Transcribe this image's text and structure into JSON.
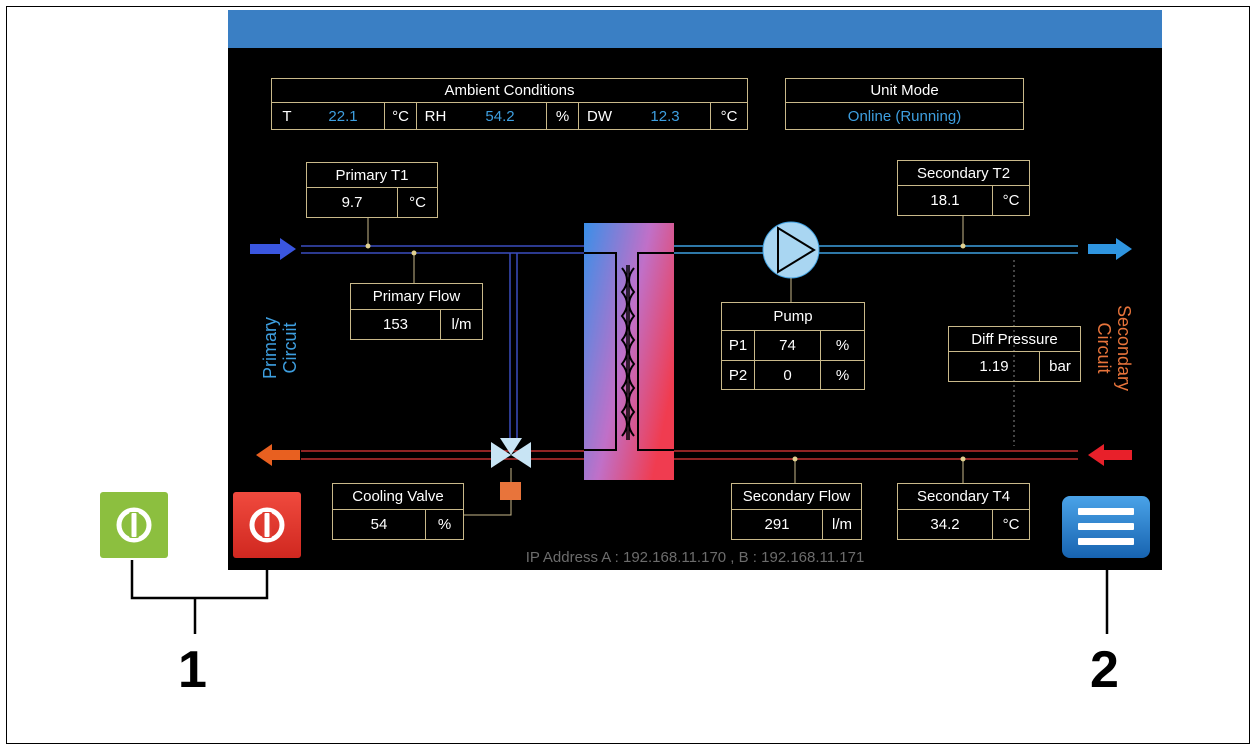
{
  "ambient": {
    "title": "Ambient Conditions",
    "t_label": "T",
    "t_value": "22.1",
    "t_unit": "°C",
    "rh_label": "RH",
    "rh_value": "54.2",
    "rh_unit": "%",
    "dw_label": "DW",
    "dw_value": "12.3",
    "dw_unit": "°C"
  },
  "unit_mode": {
    "title": "Unit Mode",
    "value": "Online (Running)"
  },
  "primary_t1": {
    "title": "Primary T1",
    "value": "9.7",
    "unit": "°C"
  },
  "secondary_t2": {
    "title": "Secondary T2",
    "value": "18.1",
    "unit": "°C"
  },
  "primary_flow": {
    "title": "Primary Flow",
    "value": "153",
    "unit": "l/m"
  },
  "pump": {
    "title": "Pump",
    "p1_label": "P1",
    "p1_value": "74",
    "p1_unit": "%",
    "p2_label": "P2",
    "p2_value": "0",
    "p2_unit": "%"
  },
  "diff_pressure": {
    "title": "Diff Pressure",
    "value": "1.19",
    "unit": "bar"
  },
  "cooling_valve": {
    "title": "Cooling Valve",
    "value": "54",
    "unit": "%"
  },
  "secondary_flow": {
    "title": "Secondary Flow",
    "value": "291",
    "unit": "l/m"
  },
  "secondary_t4": {
    "title": "Secondary T4",
    "value": "34.2",
    "unit": "°C"
  },
  "primary_circuit": {
    "line1": "Primary",
    "line2": "Circuit"
  },
  "secondary_circuit": {
    "line1": "Secondary",
    "line2": "Circuit"
  },
  "footer": {
    "ip_text": "IP Address  A : 192.168.11.170   ,   B : 192.168.11.171"
  },
  "callouts": {
    "one": "1",
    "two": "2"
  },
  "icons": {
    "start": "power-icon",
    "stop": "power-icon",
    "menu": "hamburger-menu-icon",
    "pump": "pump-icon",
    "valve": "three-way-valve-icon",
    "exchanger": "heat-exchanger-icon"
  },
  "colors": {
    "accent_blue": "#3a7fc4",
    "value_blue": "#3e9fe0",
    "hot_red": "#e8202a",
    "start_green": "#8cbf3f",
    "stop_red": "#e53935",
    "label_border": "#c9b98a",
    "secondary_orange": "#e8743b"
  }
}
